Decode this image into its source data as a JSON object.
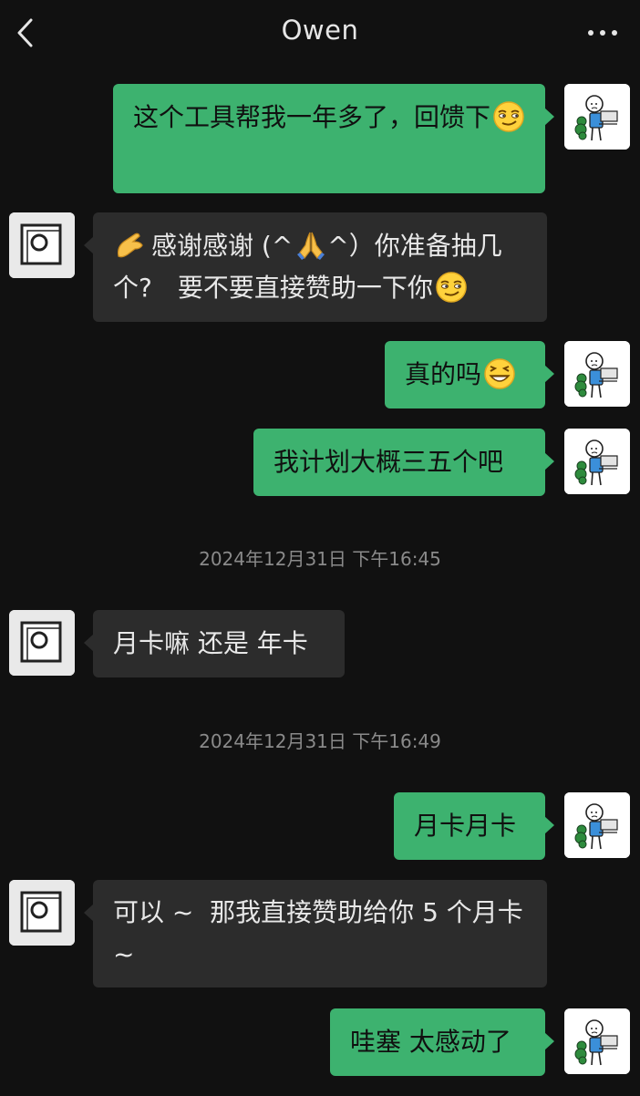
{
  "header": {
    "back_icon": "chevron-left-icon",
    "title": "Owen",
    "more_icon": "ellipsis-icon"
  },
  "messages": [
    {
      "side": "right",
      "text": "这个工具帮我一年多了，回馈下",
      "emoji": "smirking-face"
    },
    {
      "side": "left",
      "lead_emoji": "pinching-hand",
      "text_a": "感谢感谢 (^",
      "mid_emoji": "folded-hands",
      "text_b": "^）你准备抽几个?　要不要直接赞助一下你",
      "emoji": "smirking-face"
    },
    {
      "side": "right",
      "text": "真的吗",
      "emoji": "grinning-squinting-face"
    },
    {
      "side": "right",
      "text": "我计划大概三五个吧"
    },
    {
      "side": "left",
      "text": "月卡嘛 还是 年卡"
    },
    {
      "side": "right",
      "text": "月卡月卡"
    },
    {
      "side": "left",
      "text": "可以 ~  那我直接赞助给你 5 个月卡 ~"
    },
    {
      "side": "right",
      "text": "哇塞 太感动了"
    }
  ],
  "timestamps": [
    "2024年12月31日 下午16:45",
    "2024年12月31日 下午16:49"
  ],
  "colors": {
    "background": "#111111",
    "sent_bubble": "#3db26f",
    "received_bubble": "#2c2c2c",
    "timestamp": "#8a8a8a"
  }
}
